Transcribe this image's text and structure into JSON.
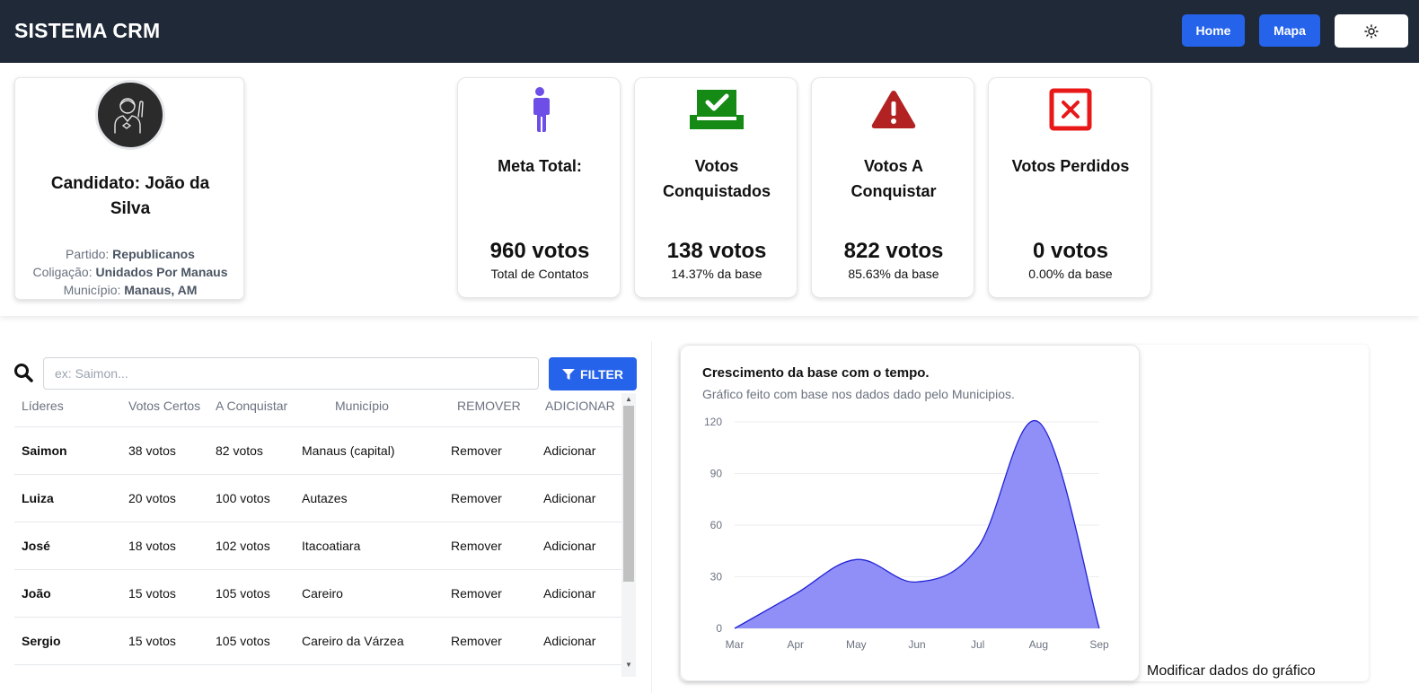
{
  "header": {
    "brand": "SISTEMA CRM",
    "home_label": "Home",
    "mapa_label": "Mapa",
    "theme_icon": "sun-icon"
  },
  "candidate": {
    "name": "Candidato: João da Silva",
    "partido_label": "Partido:",
    "partido": "Republicanos",
    "coligacao_label": "Coligação:",
    "coligacao": "Unidados Por Manaus",
    "municipio_label": "Município:",
    "municipio": "Manaus, AM",
    "avatar_icon": "candidate-avatar-icon"
  },
  "stats": [
    {
      "title": "Meta Total:",
      "value": "960 votos",
      "sub": "Total de Contatos",
      "icon": "person-icon",
      "color": "#6d4ee6"
    },
    {
      "title": "Votos Conquistados",
      "value": "138 votos",
      "sub": "14.37% da base",
      "icon": "ballot-check-icon",
      "color": "#158a15"
    },
    {
      "title": "Votos A Conquistar",
      "value": "822 votos",
      "sub": "85.63% da base",
      "icon": "warning-icon",
      "color": "#b32222"
    },
    {
      "title": "Votos Perdidos",
      "value": "0 votos",
      "sub": "0.00% da base",
      "icon": "x-square-icon",
      "color": "#e81818"
    }
  ],
  "search": {
    "placeholder": "ex: Saimon...",
    "value": "",
    "filter_label": "FILTER"
  },
  "table": {
    "headers": [
      "Líderes",
      "Votos Certos",
      "A Conquistar",
      "Município",
      "REMOVER",
      "ADICIONAR"
    ],
    "rows": [
      {
        "name": "Saimon",
        "certos": "38 votos",
        "conquistar": "82 votos",
        "municipio": "Manaus (capital)",
        "remover": "Remover",
        "adicionar": "Adicionar"
      },
      {
        "name": "Luiza",
        "certos": "20 votos",
        "conquistar": "100 votos",
        "municipio": "Autazes",
        "remover": "Remover",
        "adicionar": "Adicionar"
      },
      {
        "name": "José",
        "certos": "18 votos",
        "conquistar": "102 votos",
        "municipio": "Itacoatiara",
        "remover": "Remover",
        "adicionar": "Adicionar"
      },
      {
        "name": "João",
        "certos": "15 votos",
        "conquistar": "105 votos",
        "municipio": "Careiro",
        "remover": "Remover",
        "adicionar": "Adicionar"
      },
      {
        "name": "Sergio",
        "certos": "15 votos",
        "conquistar": "105 votos",
        "municipio": "Careiro da Várzea",
        "remover": "Remover",
        "adicionar": "Adicionar"
      }
    ]
  },
  "chart": {
    "title": "Crescimento da base com o tempo.",
    "description": "Gráfico feito com base nos dados dado pelo Municipios.",
    "modify_label": "Modificar dados do gráfico"
  },
  "chart_data": {
    "type": "area",
    "categories": [
      "Mar",
      "Apr",
      "May",
      "Jun",
      "Jul",
      "Aug",
      "Sep"
    ],
    "values": [
      0,
      20,
      40,
      27,
      47,
      120,
      0
    ],
    "yticks": [
      0,
      30,
      60,
      90,
      120
    ],
    "ylim": [
      0,
      120
    ],
    "xlabel": "",
    "ylabel": "",
    "grid": true,
    "fill_color": "#8f8ff7",
    "line_color": "#2323d6"
  }
}
